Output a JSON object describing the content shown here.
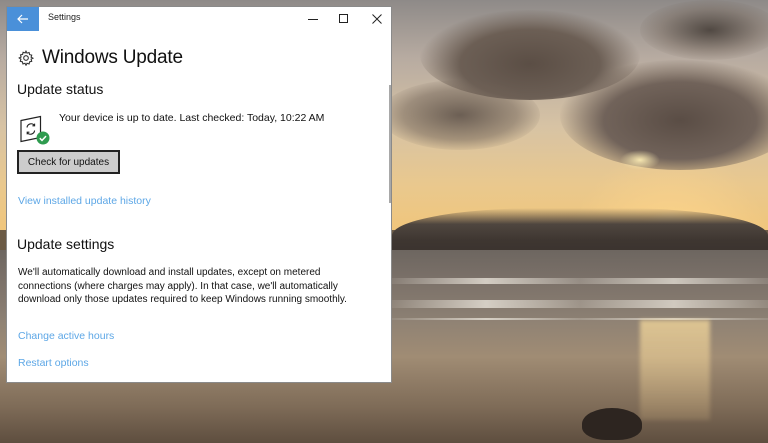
{
  "window": {
    "title": "Settings",
    "controls": {
      "minimize": "minimize-icon",
      "maximize": "maximize-icon",
      "close": "close-icon"
    }
  },
  "page": {
    "title": "Windows Update",
    "icon": "gear-icon"
  },
  "update_status": {
    "heading": "Update status",
    "status_text": "Your device is up to date. Last checked: Today, 10:22 AM",
    "status_icon": "update-success-icon",
    "check_button": "Check for updates",
    "history_link": "View installed update history"
  },
  "update_settings": {
    "heading": "Update settings",
    "description": "We'll automatically download and install updates, except on metered connections (where charges may apply). In that case, we'll automatically download only those updates required to keep Windows running smoothly.",
    "links": {
      "active_hours": "Change active hours",
      "restart": "Restart options"
    }
  },
  "colors": {
    "accent": "#4a90d9",
    "link": "#5da7e6",
    "success": "#2e9b4f",
    "button_bg": "#cccccc"
  }
}
